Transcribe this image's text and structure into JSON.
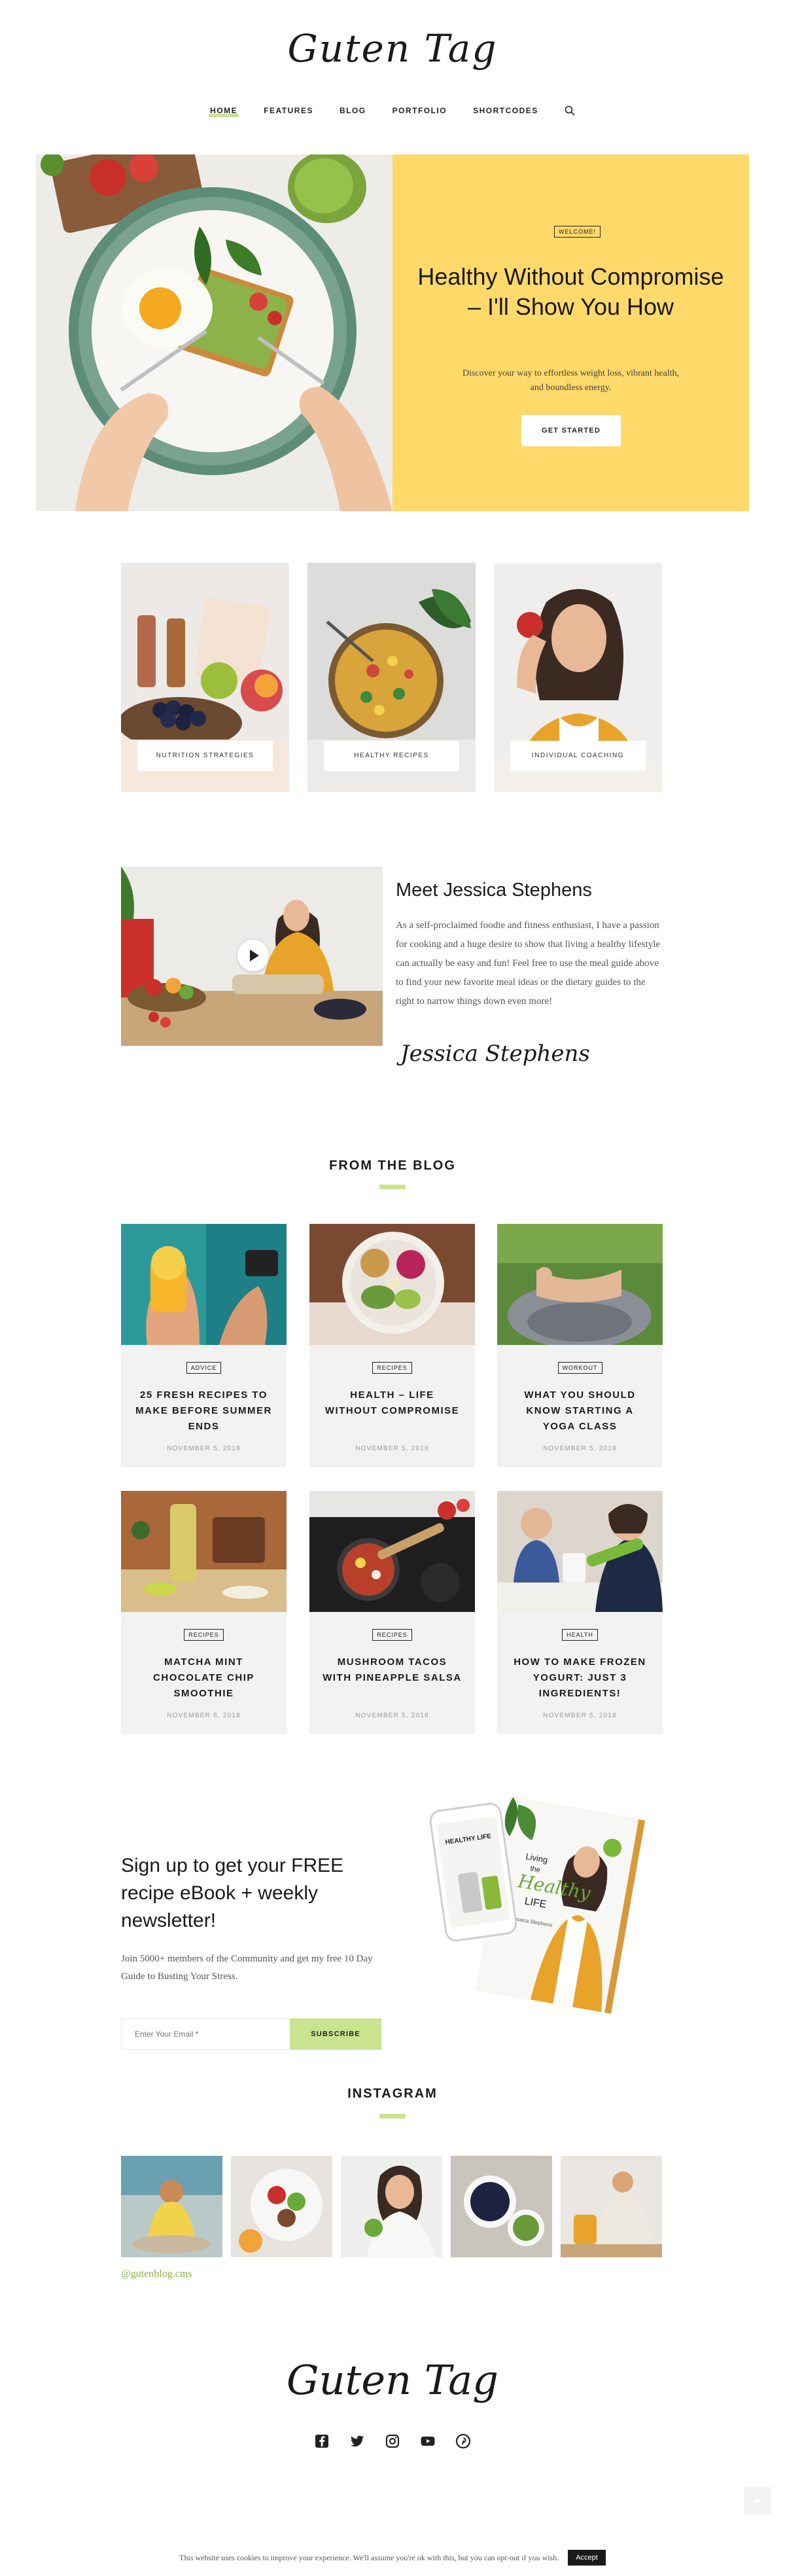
{
  "brand": {
    "logo_text": "Guten Tag"
  },
  "nav": {
    "items": [
      {
        "label": "HOME",
        "active": true
      },
      {
        "label": "FEATURES",
        "active": false
      },
      {
        "label": "BLOG",
        "active": false
      },
      {
        "label": "PORTFOLIO",
        "active": false
      },
      {
        "label": "SHORTCODES",
        "active": false
      }
    ],
    "search_icon": "search-icon"
  },
  "hero": {
    "badge": "WELCOME!",
    "title": "Healthy Without Compromise – I'll Show You How",
    "subtitle": "Discover your way to effortless weight loss, vibrant health, and boundless energy.",
    "button": "GET STARTED",
    "panel_color": "#ffd96a"
  },
  "categories": [
    {
      "label": "NUTRITION STRATEGIES"
    },
    {
      "label": "HEALTHY RECIPES"
    },
    {
      "label": "INDIVIDUAL COACHING"
    }
  ],
  "meet": {
    "title": "Meet Jessica Stephens",
    "text": "As a self-proclaimed foodie and fitness enthusiast, I have a passion for cooking and a huge desire to show that living a healthy lifestyle can actually be easy and fun! Feel free to use the meal guide above to find your new favorite meal ideas or the dietary guides to the right to narrow things down even more!",
    "signature": "Jessica Stephens"
  },
  "blog": {
    "title": "FROM THE BLOG",
    "posts": [
      {
        "category": "ADVICE",
        "title": "25 FRESH RECIPES TO MAKE BEFORE SUMMER ENDS",
        "date": "NOVEMBER 5, 2018"
      },
      {
        "category": "RECIPES",
        "title": "HEALTH – LIFE WITHOUT COMPROMISE",
        "date": "NOVEMBER 5, 2018"
      },
      {
        "category": "WORKOUT",
        "title": "WHAT YOU SHOULD KNOW STARTING A YOGA CLASS",
        "date": "NOVEMBER 5, 2018"
      },
      {
        "category": "RECIPES",
        "title": "MATCHA MINT CHOCOLATE CHIP SMOOTHIE",
        "date": "NOVEMBER 5, 2018"
      },
      {
        "category": "RECIPES",
        "title": "MUSHROOM TACOS WITH PINEAPPLE SALSA",
        "date": "NOVEMBER 5, 2018"
      },
      {
        "category": "HEALTH",
        "title": "HOW TO MAKE FROZEN YOGURT: JUST 3 INGREDIENTS!",
        "date": "NOVEMBER 5, 2018"
      }
    ]
  },
  "newsletter": {
    "title": "Sign up to get your FREE recipe eBook + weekly newsletter!",
    "text": "Join 5000+ members of the Community and get my free 10 Day Guide to Busting Your Stress.",
    "placeholder": "Enter Your Email *",
    "button": "SUBSCRIBE",
    "accent": "#c9e38f",
    "book": {
      "title_line1": "Living",
      "title_line2": "the",
      "title_line3": "Healthy",
      "title_line4": "LIFE",
      "author": "Jessica Stephens",
      "phone_title": "HEALTHY LIFE"
    }
  },
  "instagram": {
    "title": "INSTAGRAM",
    "handle": "@gutenblog.cms"
  },
  "footer": {
    "logo_text": "Guten Tag",
    "social": [
      "facebook-icon",
      "twitter-icon",
      "instagram-icon",
      "youtube-icon",
      "pinterest-icon"
    ]
  },
  "cookie": {
    "text": "This website uses cookies to improve your experience. We'll assume you're ok with this, but you can opt-out if you wish.",
    "button": "Accept"
  }
}
